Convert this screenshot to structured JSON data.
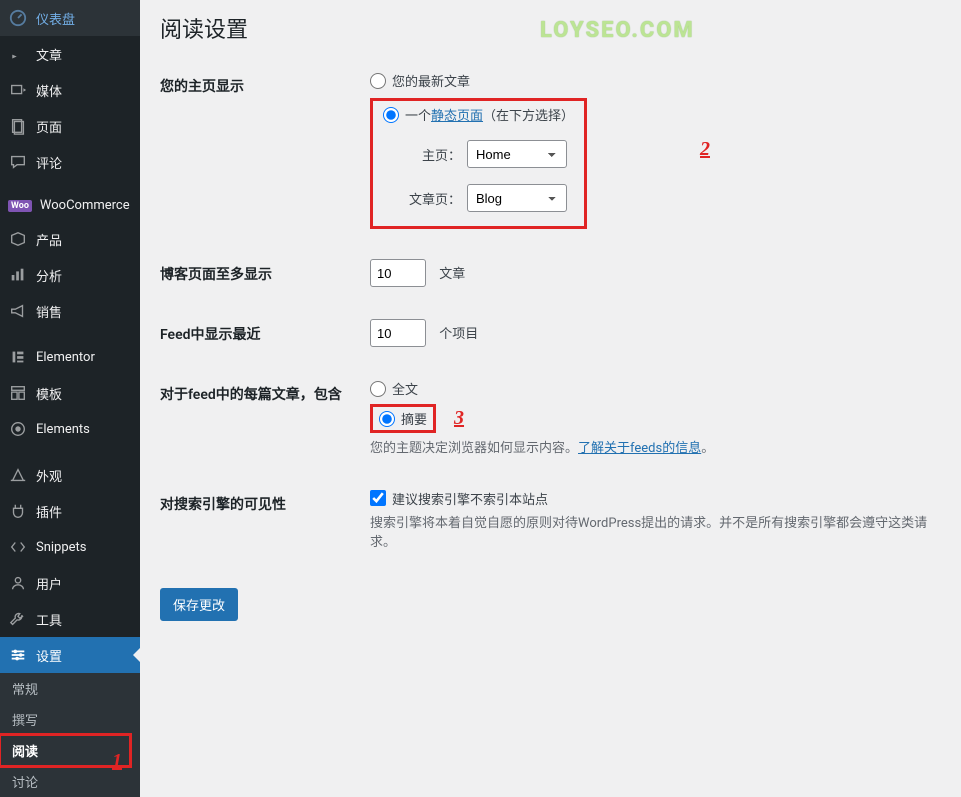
{
  "watermark": "LOYSEO.COM",
  "annotations": {
    "a1": "1",
    "a2": "2",
    "a3": "3"
  },
  "sidebar": {
    "items": [
      {
        "label": "仪表盘",
        "icon": "dashboard"
      },
      {
        "label": "文章",
        "icon": "pin"
      },
      {
        "label": "媒体",
        "icon": "media"
      },
      {
        "label": "页面",
        "icon": "page"
      },
      {
        "label": "评论",
        "icon": "comment"
      },
      {
        "label": "WooCommerce",
        "icon": "woo"
      },
      {
        "label": "产品",
        "icon": "product"
      },
      {
        "label": "分析",
        "icon": "analytics"
      },
      {
        "label": "销售",
        "icon": "marketing"
      },
      {
        "label": "Elementor",
        "icon": "elementor"
      },
      {
        "label": "模板",
        "icon": "template"
      },
      {
        "label": "Elements",
        "icon": "elements"
      },
      {
        "label": "外观",
        "icon": "appearance"
      },
      {
        "label": "插件",
        "icon": "plugin"
      },
      {
        "label": "Snippets",
        "icon": "snippets"
      },
      {
        "label": "用户",
        "icon": "user"
      },
      {
        "label": "工具",
        "icon": "tool"
      },
      {
        "label": "设置",
        "icon": "settings"
      }
    ],
    "submenu": [
      {
        "label": "常规"
      },
      {
        "label": "撰写"
      },
      {
        "label": "阅读"
      },
      {
        "label": "讨论"
      }
    ]
  },
  "page": {
    "title": "阅读设置",
    "homepage": {
      "label": "您的主页显示",
      "opt_latest": "您的最新文章",
      "opt_static_prefix": "一个",
      "opt_static_link": "静态页面",
      "opt_static_suffix": "（在下方选择）",
      "home_label": "主页：",
      "home_value": "Home",
      "posts_label": "文章页：",
      "posts_value": "Blog"
    },
    "blog_show": {
      "label": "博客页面至多显示",
      "value": "10",
      "unit": "文章"
    },
    "feed_recent": {
      "label": "Feed中显示最近",
      "value": "10",
      "unit": "个项目"
    },
    "feed_each": {
      "label": "对于feed中的每篇文章，包含",
      "opt_full": "全文",
      "opt_summary": "摘要",
      "desc_prefix": "您的主题决定浏览器如何显示内容。",
      "desc_link": "了解关于feeds的信息",
      "desc_suffix": "。"
    },
    "search_vis": {
      "label": "对搜索引擎的可见性",
      "checkbox": "建议搜索引擎不索引本站点",
      "desc": "搜索引擎将本着自觉自愿的原则对待WordPress提出的请求。并不是所有搜索引擎都会遵守这类请求。"
    },
    "save": "保存更改"
  }
}
